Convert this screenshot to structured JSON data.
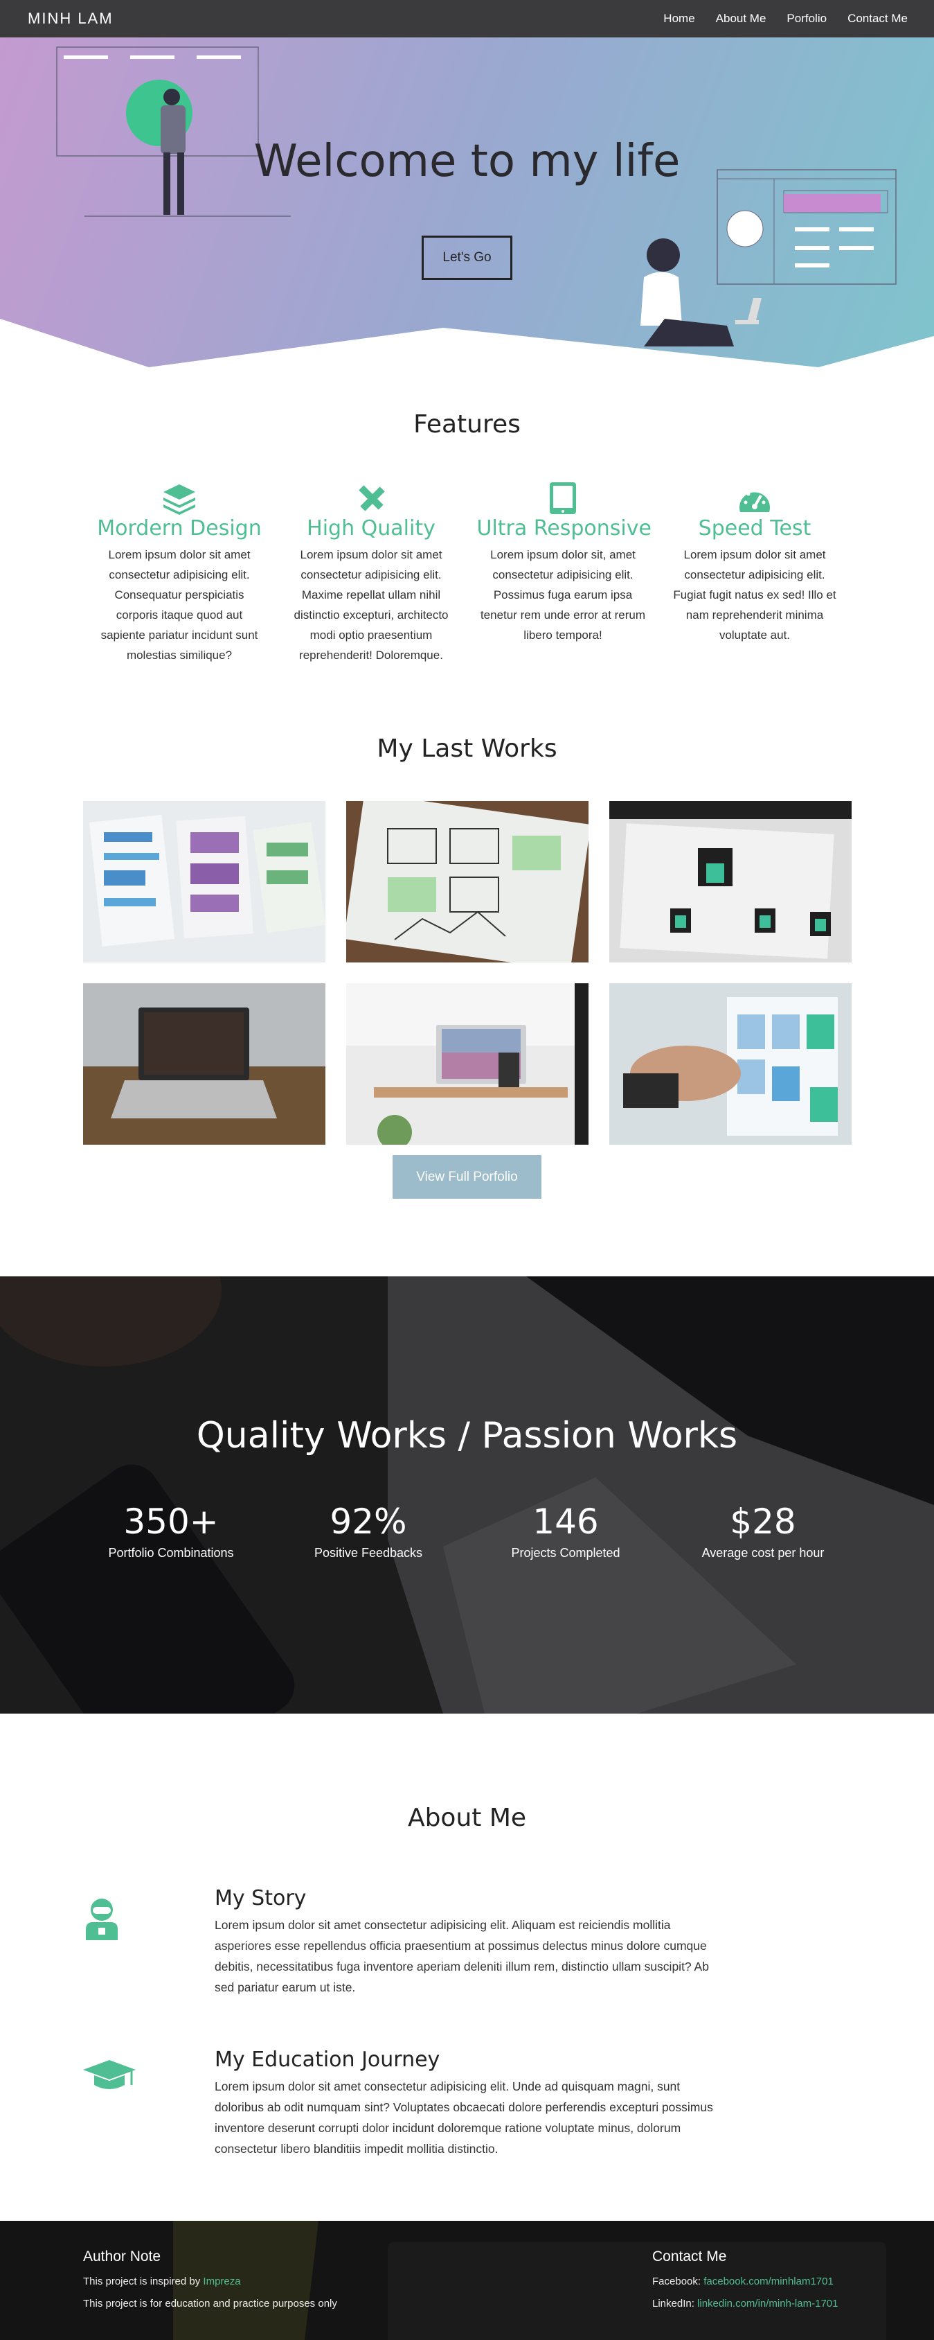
{
  "nav": {
    "brand": "MINH LAM",
    "links": [
      "Home",
      "About Me",
      "Porfolio",
      "Contact Me"
    ]
  },
  "hero": {
    "title": "Welcome to my life",
    "button": "Let's Go"
  },
  "features": {
    "title": "Features",
    "items": [
      {
        "icon": "layers-icon",
        "title": "Mordern Design",
        "text": "Lorem ipsum dolor sit amet consectetur adipisicing elit. Consequatur perspiciatis corporis itaque quod aut sapiente pariatur incidunt sunt molestias similique?"
      },
      {
        "icon": "pencil-ruler-icon",
        "title": "High Quality",
        "text": "Lorem ipsum dolor sit amet consectetur adipisicing elit. Maxime repellat ullam nihil distinctio excepturi, architecto modi optio praesentium reprehenderit! Doloremque."
      },
      {
        "icon": "tablet-icon",
        "title": "Ultra Responsive",
        "text": "Lorem ipsum dolor sit, amet consectetur adipisicing elit. Possimus fuga earum ipsa tenetur rem unde error at rerum libero tempora!"
      },
      {
        "icon": "speedometer-icon",
        "title": "Speed Test",
        "text": "Lorem ipsum dolor sit amet consectetur adipisicing elit. Fugiat fugit natus ex sed! Illo et nam reprehenderit minima voluptate aut."
      }
    ]
  },
  "works": {
    "title": "My Last Works",
    "button": "View Full Porfolio"
  },
  "stats": {
    "title": "Quality Works / Passion Works",
    "items": [
      {
        "value": "350+",
        "label": "Portfolio Combinations"
      },
      {
        "value": "92%",
        "label": "Positive Feedbacks"
      },
      {
        "value": "146",
        "label": "Projects Completed"
      },
      {
        "value": "$28",
        "label": "Average cost per hour"
      }
    ]
  },
  "about": {
    "title": "About Me",
    "items": [
      {
        "icon": "user-icon",
        "title": "My Story",
        "text": "Lorem ipsum dolor sit amet consectetur adipisicing elit. Aliquam est reiciendis mollitia asperiores esse repellendus officia praesentium at possimus delectus minus dolore cumque debitis, necessitatibus fuga inventore aperiam deleniti illum rem, distinctio ullam suscipit? Ab sed pariatur earum ut iste."
      },
      {
        "icon": "graduation-cap-icon",
        "title": "My Education Journey",
        "text": "Lorem ipsum dolor sit amet consectetur adipisicing elit. Unde ad quisquam magni, sunt doloribus ab odit numquam sint? Voluptates obcaecati dolore perferendis excepturi possimus inventore deserunt corrupti dolor incidunt doloremque ratione voluptate minus, dolorum consectetur libero blanditiis impedit mollitia distinctio."
      }
    ]
  },
  "footer": {
    "author": {
      "title": "Author Note",
      "line1_prefix": "This project is inspired by ",
      "line1_link": "Impreza",
      "line2": "This project is for education and practice purposes only"
    },
    "contact": {
      "title": "Contact Me",
      "facebook_label": "Facebook: ",
      "facebook_link": "facebook.com/minhlam1701",
      "linkedin_label": "LinkedIn: ",
      "linkedin_link": "linkedin.com/in/minh-lam-1701"
    }
  },
  "colors": {
    "accent": "#4fbf93",
    "nav_bg": "#3b3b3e",
    "button_blue": "#9cbccb"
  }
}
